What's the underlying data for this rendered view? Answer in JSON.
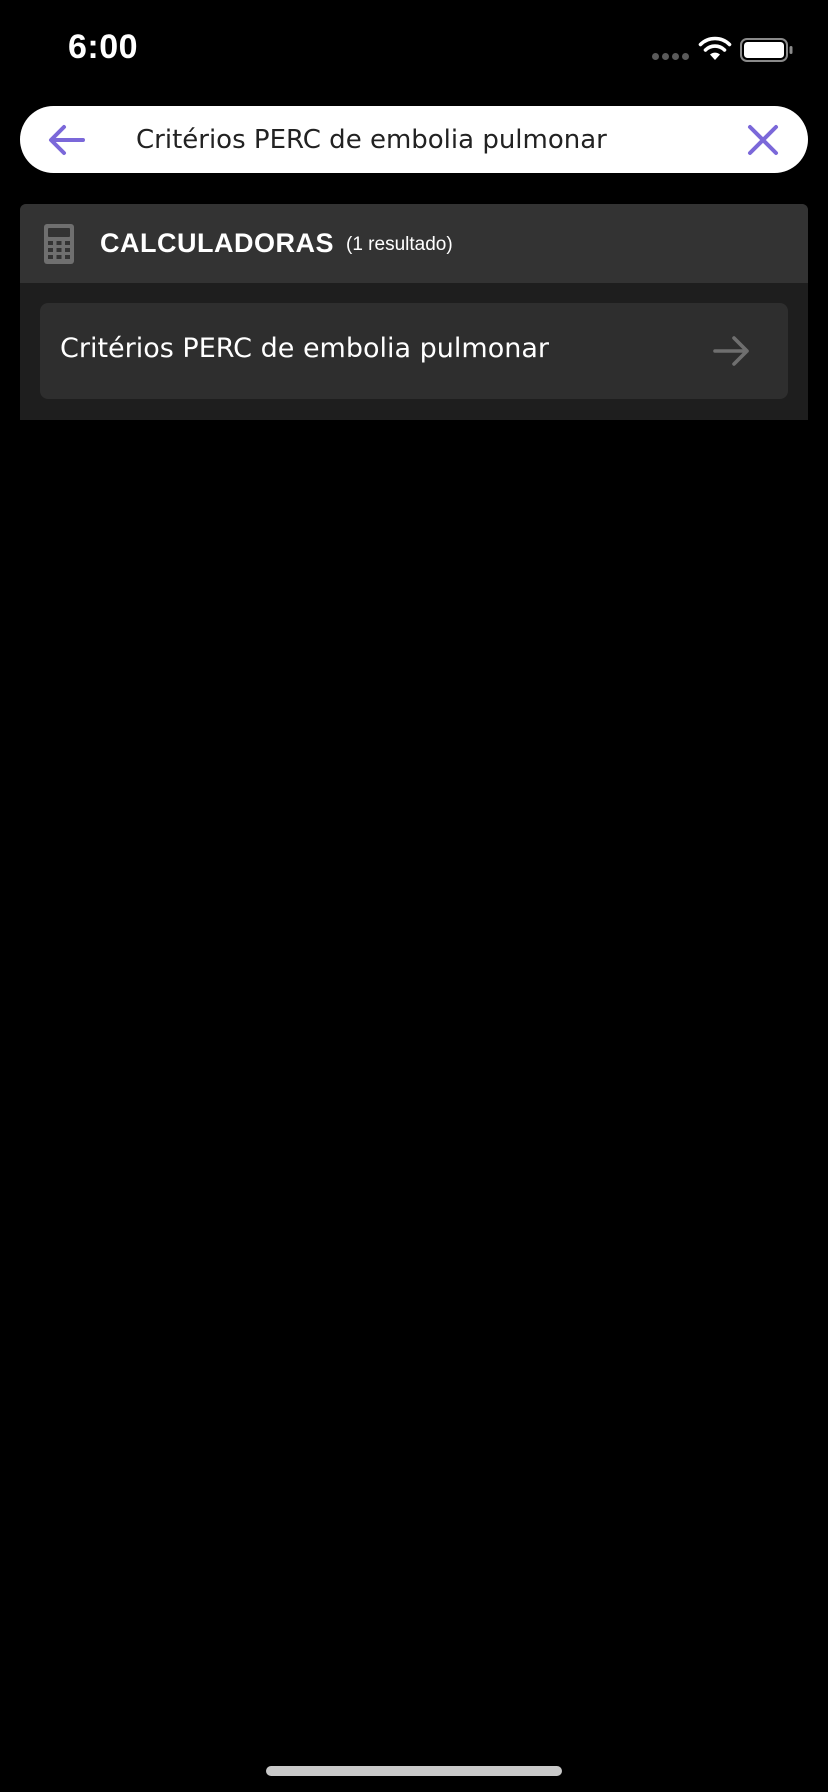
{
  "status_bar": {
    "time": "6:00",
    "signal_icon": "signal-dots-icon",
    "wifi_icon": "wifi-icon",
    "battery_icon": "battery-icon"
  },
  "search": {
    "back_icon": "arrow-left-icon",
    "query": "Critérios PERC de embolia pulmonar",
    "clear_icon": "close-icon"
  },
  "results": {
    "sections": [
      {
        "icon": "calculator-icon",
        "title": "CALCULADORAS",
        "count_label": "(1 resultado)",
        "items": [
          {
            "label": "Critérios PERC de embolia pulmonar",
            "icon": "arrow-right-icon"
          }
        ]
      }
    ]
  },
  "colors": {
    "background": "#000000",
    "accent": "#7b68d9",
    "panel": "#1e1e1e",
    "section_header": "#333333",
    "item": "#2e2e2e",
    "muted_icon": "#6f6f6f"
  }
}
